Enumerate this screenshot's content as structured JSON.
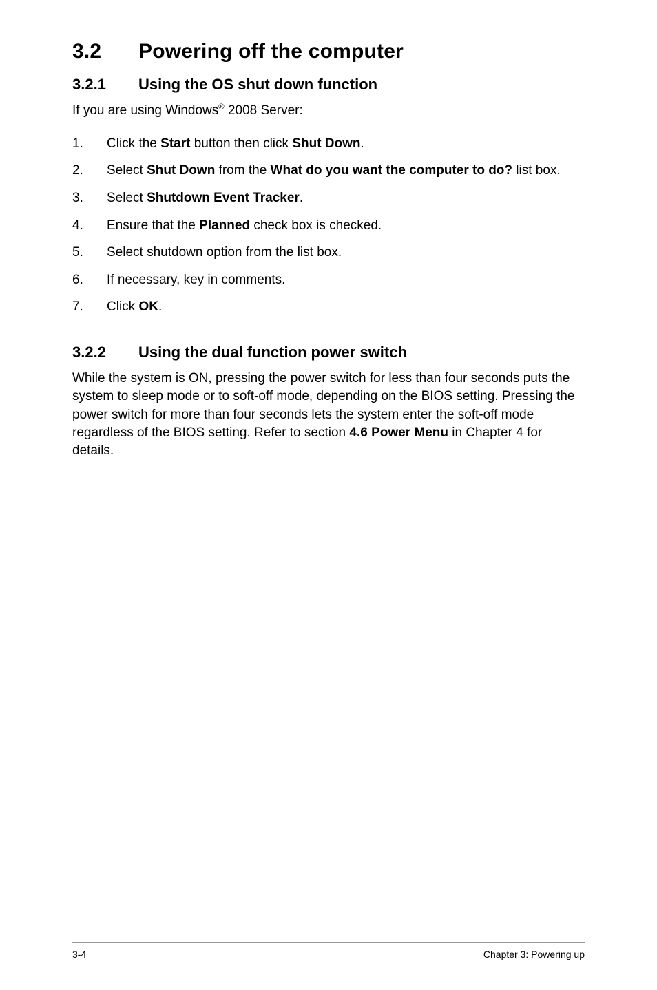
{
  "chapter": {
    "section_number": "3.2",
    "section_title": "Powering off the computer"
  },
  "sub1": {
    "number": "3.2.1",
    "title": "Using the OS shut down function",
    "intro_pre": "If you are using Windows",
    "intro_sup": "®",
    "intro_post": " 2008 Server:",
    "steps": [
      {
        "pre": "Click the ",
        "b1": "Start",
        "mid": " button then click ",
        "b2": "Shut Down",
        "post": "."
      },
      {
        "pre": "Select ",
        "b1": "Shut Down",
        "mid": " from the ",
        "b2": "What do you want the computer to do?",
        "post": " list box."
      },
      {
        "pre": "Select ",
        "b1": "Shutdown Event Tracker",
        "post": "."
      },
      {
        "pre": "Ensure that the ",
        "b1": "Planned",
        "post": " check box is checked."
      },
      {
        "pre": "Select shutdown option from the list box."
      },
      {
        "pre": "If necessary, key in comments."
      },
      {
        "pre": "Click ",
        "b1": "OK",
        "post": "."
      }
    ]
  },
  "sub2": {
    "number": "3.2.2",
    "title": "Using the dual function power switch",
    "body_pre": "While the system is ON, pressing the power switch for less than four seconds puts the system to sleep mode or to soft-off mode, depending on the BIOS setting. Pressing the power switch for more than four seconds lets the system enter the soft-off mode regardless of the BIOS setting. Refer to section ",
    "body_bold": "4.6  Power Menu",
    "body_post": " in Chapter 4 for details."
  },
  "footer": {
    "page_number": "3-4",
    "chapter_label": "Chapter 3: Powering up"
  }
}
